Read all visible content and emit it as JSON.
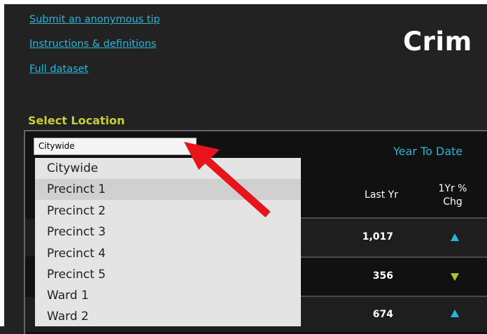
{
  "links": {
    "tip": "Submit an anonymous tip",
    "instructions": "Instructions & definitions",
    "dataset": "Full dataset"
  },
  "page_title": "Crim",
  "location": {
    "label": "Select Location",
    "selected": "Citywide",
    "options": [
      "Citywide",
      "Precinct 1",
      "Precinct 2",
      "Precinct 3",
      "Precinct 4",
      "Precinct 5",
      "Ward 1",
      "Ward 2"
    ],
    "hovered": "Precinct 1"
  },
  "table": {
    "section_title": "Year To Date",
    "headers": {
      "last_yr": "Last Yr",
      "chg_line1": "1Yr %",
      "chg_line2": "Chg"
    },
    "rows": [
      {
        "last_yr": "1,017",
        "trend": "up"
      },
      {
        "last_yr": "356",
        "trend": "down"
      },
      {
        "last_yr": "674",
        "trend": "up"
      }
    ]
  },
  "colors": {
    "link": "#29b6d8",
    "label_accent": "#c4cf3a",
    "trend_up": "#29b6d8",
    "trend_down": "#b5c032",
    "annotation_arrow": "#e8141b"
  }
}
